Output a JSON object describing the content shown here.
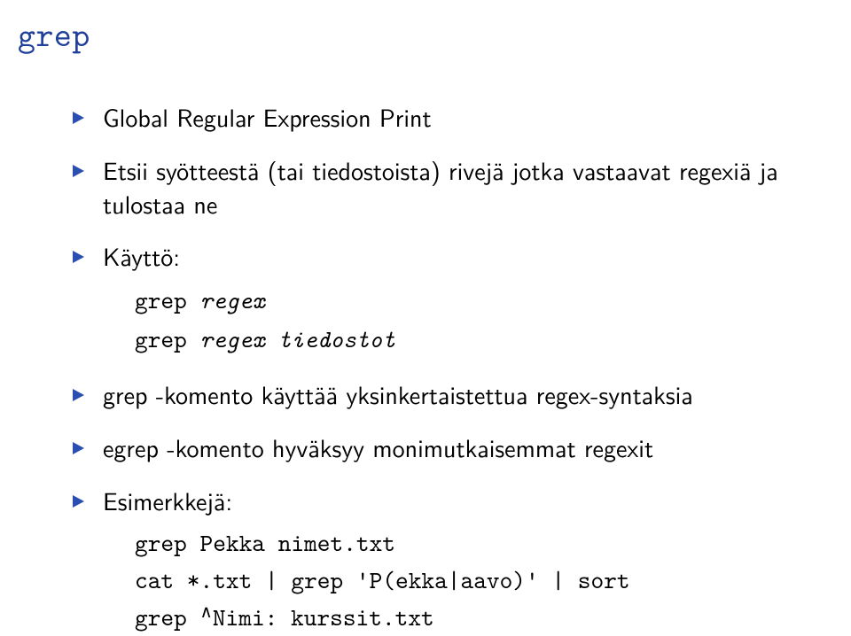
{
  "title": "grep",
  "bullets": {
    "b1": "Global Regular Expression Print",
    "b2": "Etsii syötteestä (tai tiedostoista) rivejä jotka vastaavat regexiä ja tulostaa ne",
    "b3": "Käyttö:",
    "b3_line1_cmd": "grep ",
    "b3_line1_arg": "regex",
    "b3_line2_cmd": "grep ",
    "b3_line2_arg": "regex tiedostot",
    "b4": "grep -komento käyttää yksinkertaistettua regex-syntaksia",
    "b5": "egrep -komento hyväksyy monimutkaisemmat regexit",
    "b6": "Esimerkkejä:",
    "b6_line1": "grep Pekka nimet.txt",
    "b6_line2": "cat *.txt | grep 'P(ekka|aavo)' | sort",
    "b6_line3_a": "grep ",
    "b6_line3_sup": "∧",
    "b6_line3_b": "Nimi: kurssit.txt"
  }
}
